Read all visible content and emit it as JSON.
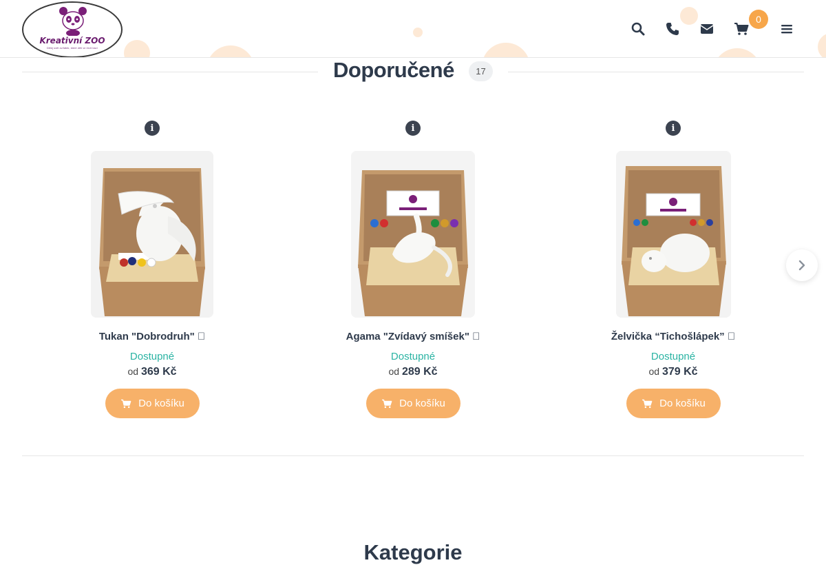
{
  "header": {
    "logo_text": "Kreativní ZOO",
    "logo_tagline": "Dělej svět zvířátek, které děti ve čtvrt baví",
    "icons": [
      "search-icon",
      "phone-icon",
      "envelope-icon",
      "cart-icon",
      "menu-icon"
    ],
    "cart_count": "0"
  },
  "section": {
    "title": "Doporučené",
    "count": "17"
  },
  "products": [
    {
      "name": "Tukan \"Dobrodruh\" ",
      "availability": "Dostupné",
      "price_prefix": "od",
      "price": "369 Kč",
      "button": "Do košíku"
    },
    {
      "name": "Agama \"Zvídavý smíšek\" ",
      "availability": "Dostupné",
      "price_prefix": "od",
      "price": "289 Kč",
      "button": "Do košíku"
    },
    {
      "name": "Želvička “Tichošlápek” ",
      "availability": "Dostupné",
      "price_prefix": "od",
      "price": "379 Kč",
      "button": "Do košíku"
    }
  ],
  "next_section": {
    "title": "Kategorie"
  },
  "colors": {
    "accent": "#f7b169",
    "available": "#2ab3a3",
    "heading": "#2e3a4b",
    "logo": "#6a1b6e"
  }
}
